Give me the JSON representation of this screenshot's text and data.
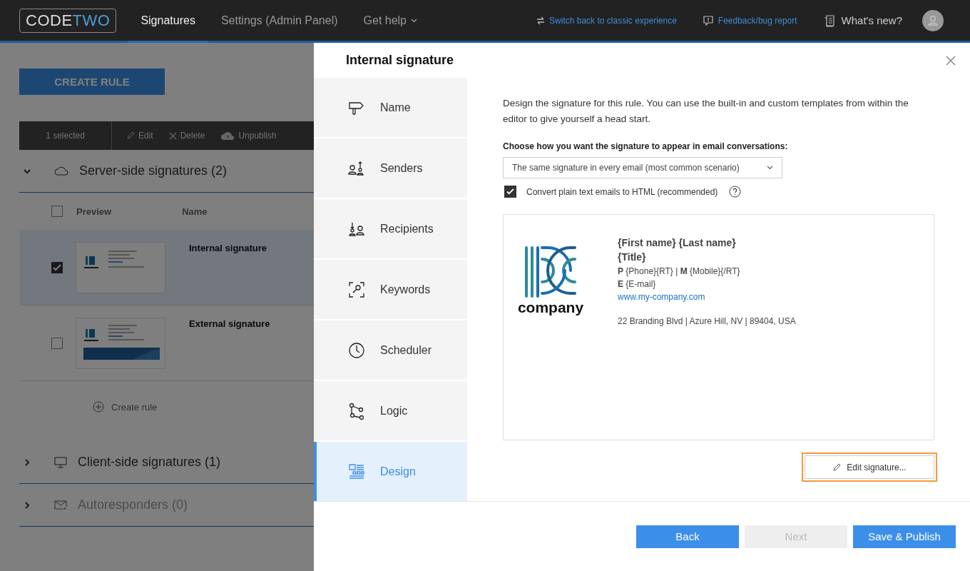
{
  "topbar": {
    "logo": {
      "left": "CODE",
      "right": "TWO"
    },
    "nav": [
      {
        "label": "Signatures",
        "selected": true,
        "menu": false
      },
      {
        "label": "Settings (Admin Panel)",
        "selected": false,
        "menu": false
      },
      {
        "label": "Get help",
        "selected": false,
        "menu": true
      }
    ],
    "links": [
      "Switch back to classic experience",
      "Feedback/bug report"
    ],
    "whats_new": "What's new?"
  },
  "page": {
    "create_button": "CREATE RULE",
    "selection": {
      "count": "1 selected",
      "actions": [
        "Edit",
        "Delete",
        "Unpublish"
      ]
    },
    "groups": [
      {
        "title": "Server-side signatures (2)",
        "expanded": true,
        "disabled": false,
        "header_checked": false,
        "columns": [
          "Preview",
          "Name"
        ],
        "rows": [
          {
            "name": "Internal signature",
            "checked": true,
            "banner": false
          },
          {
            "name": "External signature",
            "checked": false,
            "banner": true
          }
        ],
        "add_label": "Create rule"
      },
      {
        "title": "Client-side signatures (1)",
        "expanded": false,
        "disabled": false
      },
      {
        "title": "Autoresponders (0)",
        "expanded": false,
        "disabled": true
      }
    ]
  },
  "panel": {
    "title": "Internal signature",
    "steps": [
      {
        "label": "Name",
        "selected": false
      },
      {
        "label": "Senders",
        "selected": false
      },
      {
        "label": "Recipients",
        "selected": false
      },
      {
        "label": "Keywords",
        "selected": false
      },
      {
        "label": "Scheduler",
        "selected": false
      },
      {
        "label": "Logic",
        "selected": false
      },
      {
        "label": "Design",
        "selected": true
      }
    ],
    "intro": "Design the signature for this rule. You can use the built-in and custom templates from within the editor to give yourself a head start.",
    "mode_label": "Choose how you want the signature to appear in email conversations:",
    "mode_value": "The same signature in every email (most common scenario)",
    "convert": {
      "label": "Convert plain text emails to HTML (recommended)",
      "checked": true
    },
    "signature": {
      "logo_text": "company",
      "name": "{First name} {Last name}",
      "title": "{Title}",
      "phone": "**P** {Phone}{RT} | **M** {Mobile}{/RT}",
      "email": "**E** {E-mail}",
      "website": "www.my-company.com",
      "address": "22 Branding Blvd | Azure Hill, NV | 89404, USA"
    },
    "edit_button": {
      "label": "Edit signature...",
      "highlighted": true
    },
    "buttons": [
      {
        "label": "Back",
        "disabled": false
      },
      {
        "label": "Next",
        "disabled": true
      },
      {
        "label": "Save & Publish",
        "disabled": false
      }
    ]
  }
}
